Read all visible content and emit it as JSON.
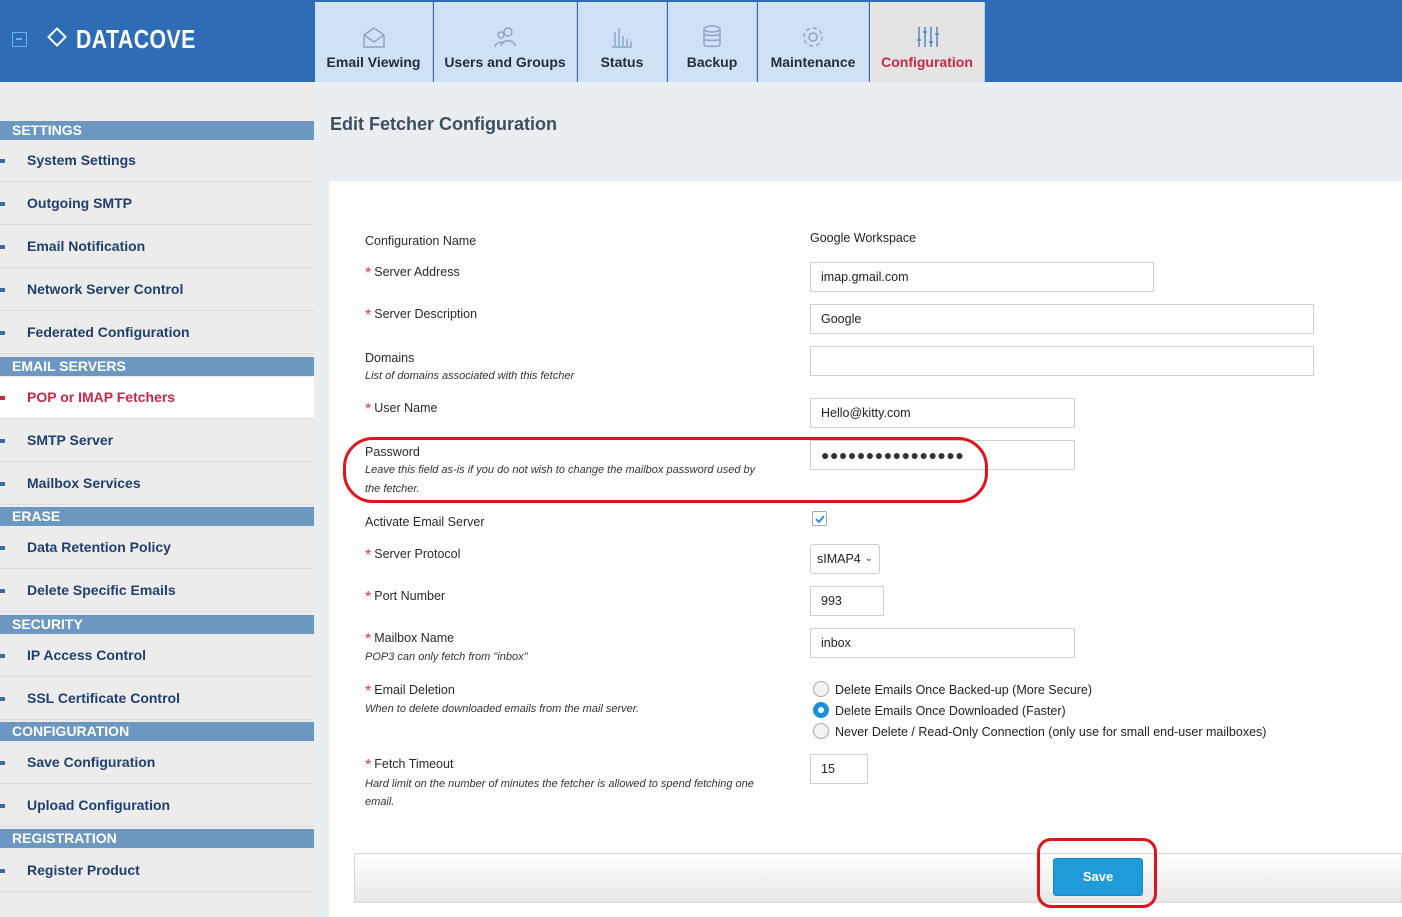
{
  "app": {
    "name": "DATACOVE"
  },
  "nav": {
    "tabs": [
      {
        "label": "Email Viewing",
        "icon": "envelope-icon"
      },
      {
        "label": "Users and Groups",
        "icon": "users-icon"
      },
      {
        "label": "Status",
        "icon": "bar-chart-icon"
      },
      {
        "label": "Backup",
        "icon": "database-icon"
      },
      {
        "label": "Maintenance",
        "icon": "gear-icon"
      },
      {
        "label": "Configuration",
        "icon": "sliders-icon",
        "active": true
      }
    ]
  },
  "sidebar": {
    "sections": [
      {
        "title": "SETTINGS",
        "items": [
          "System Settings",
          "Outgoing SMTP",
          "Email Notification",
          "Network Server Control",
          "Federated Configuration"
        ]
      },
      {
        "title": "EMAIL SERVERS",
        "items": [
          "POP or IMAP Fetchers",
          "SMTP Server",
          "Mailbox Services"
        ]
      },
      {
        "title": "ERASE",
        "items": [
          "Data Retention Policy",
          "Delete Specific Emails"
        ]
      },
      {
        "title": "SECURITY",
        "items": [
          "IP Access Control",
          "SSL Certificate Control"
        ]
      },
      {
        "title": "CONFIGURATION",
        "items": [
          "Save Configuration",
          "Upload Configuration"
        ]
      },
      {
        "title": "REGISTRATION",
        "items": [
          "Register Product"
        ]
      }
    ],
    "active_item": "POP or IMAP Fetchers"
  },
  "page": {
    "title": "Edit Fetcher Configuration"
  },
  "form": {
    "config_name": {
      "label": "Configuration Name",
      "value": "Google Workspace"
    },
    "server_address": {
      "label": "Server Address",
      "value": "imap.gmail.com"
    },
    "server_description": {
      "label": "Server Description",
      "value": "Google"
    },
    "domains": {
      "label": "Domains",
      "hint": "List of domains associated with this fetcher",
      "value": ""
    },
    "user_name": {
      "label": "User Name",
      "value": "Hello@kitty.com"
    },
    "password": {
      "label": "Password",
      "hint_line1": "Leave this field as-is if you do not wish to change the mailbox password used by",
      "hint_line2": "the fetcher.",
      "value": "●●●●●●●●●●●●●●●●"
    },
    "activate": {
      "label": "Activate Email Server",
      "checked": true
    },
    "protocol": {
      "label": "Server Protocol",
      "value": "sIMAP4"
    },
    "port": {
      "label": "Port Number",
      "value": "993"
    },
    "mailbox": {
      "label": "Mailbox Name",
      "hint": "POP3 can only fetch from \"inbox\"",
      "value": "inbox"
    },
    "deletion": {
      "label": "Email Deletion",
      "hint": "When to delete downloaded emails from the mail server.",
      "options": [
        "Delete Emails Once Backed-up (More Secure)",
        "Delete Emails Once Downloaded (Faster)",
        "Never Delete / Read-Only Connection (only use for small end-user mailboxes)"
      ],
      "selected_index": 1
    },
    "timeout": {
      "label": "Fetch Timeout",
      "hint_line1": "Hard limit on the number of minutes the fetcher is allowed to spend fetching one",
      "hint_line2": "email.",
      "value": "15"
    },
    "save_label": "Save"
  },
  "colors": {
    "header": "#2e6db5",
    "accent": "#c62845",
    "save": "#1e9bd8",
    "annotation": "#e1141e"
  }
}
